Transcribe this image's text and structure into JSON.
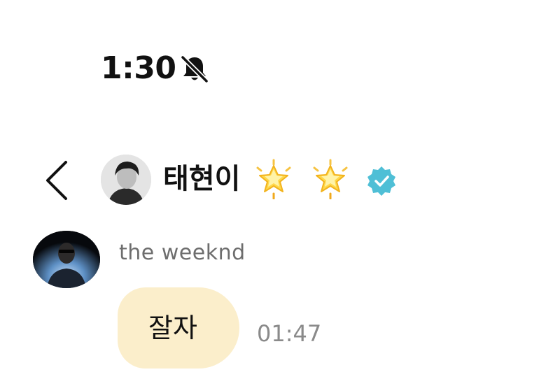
{
  "status_bar": {
    "time": "1:30",
    "mute_icon": "bell-slash-icon"
  },
  "header": {
    "back_icon": "chevron-left-icon",
    "avatar": "profile-photo",
    "title": "태현이",
    "title_emoji": [
      "star-emoji",
      "star-emoji"
    ],
    "verified_icon": "verified-badge-icon",
    "verified_color": "#4fbfd6"
  },
  "message": {
    "sender_name": "the weeknd",
    "sender_avatar": "profile-photo",
    "text": "잘자",
    "time": "01:47",
    "bubble_color": "#fbeecb"
  }
}
